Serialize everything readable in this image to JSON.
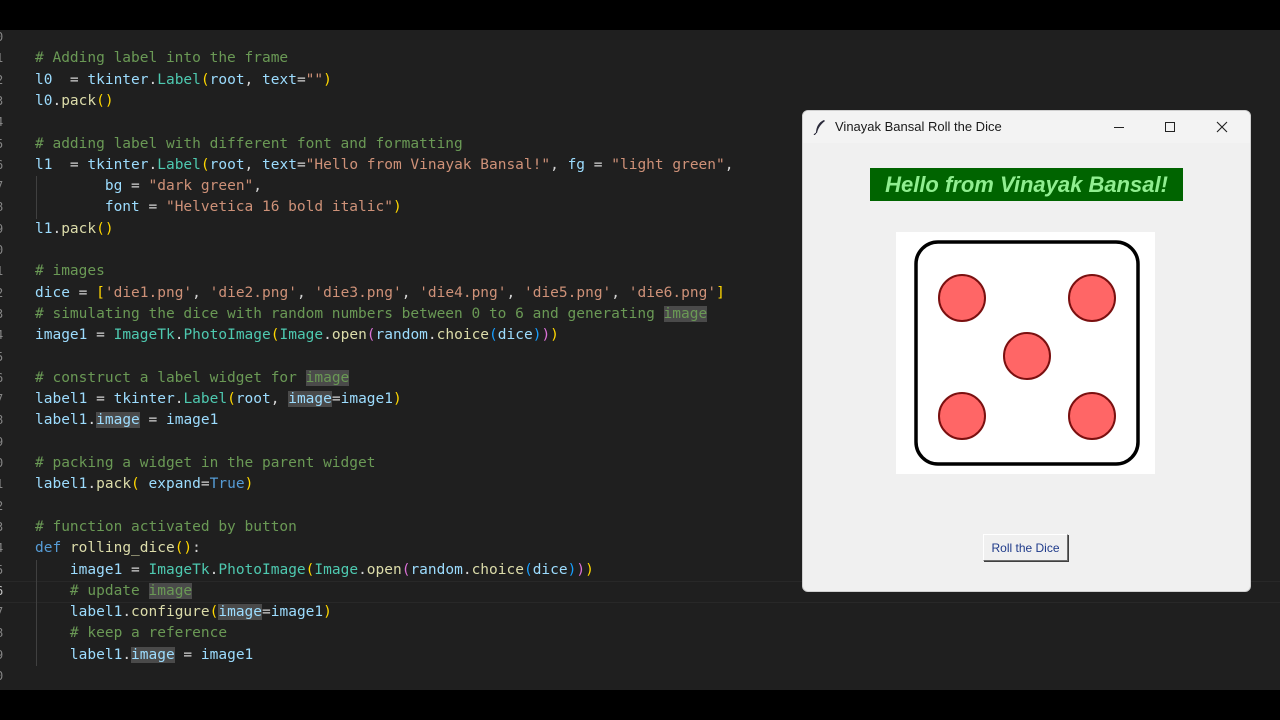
{
  "editor": {
    "current_line": "26",
    "lines": [
      {
        "n": "0"
      },
      {
        "n": "1",
        "t": [
          [
            "cm",
            "# Adding label into the frame"
          ]
        ]
      },
      {
        "n": "2",
        "t": [
          [
            "var",
            "l0"
          ],
          [
            "",
            "  = "
          ],
          [
            "var",
            "tkinter"
          ],
          [
            "",
            "."
          ],
          [
            "cls",
            "Label"
          ],
          [
            "p1",
            "("
          ],
          [
            "var",
            "root"
          ],
          [
            "",
            ", "
          ],
          [
            "var",
            "text"
          ],
          [
            "",
            "="
          ],
          [
            "str",
            "\"\""
          ],
          [
            "p1",
            ")"
          ]
        ]
      },
      {
        "n": "3",
        "t": [
          [
            "var",
            "l0"
          ],
          [
            "",
            "."
          ],
          [
            "fn",
            "pack"
          ],
          [
            "p1",
            "()"
          ]
        ]
      },
      {
        "n": "4"
      },
      {
        "n": "5",
        "t": [
          [
            "cm",
            "# adding label with different font and formatting"
          ]
        ]
      },
      {
        "n": "6",
        "t": [
          [
            "var",
            "l1"
          ],
          [
            "",
            "  = "
          ],
          [
            "var",
            "tkinter"
          ],
          [
            "",
            "."
          ],
          [
            "cls",
            "Label"
          ],
          [
            "p1",
            "("
          ],
          [
            "var",
            "root"
          ],
          [
            "",
            ", "
          ],
          [
            "var",
            "text"
          ],
          [
            "",
            "="
          ],
          [
            "str",
            "\"Hello from Vinayak Bansal!\""
          ],
          [
            "",
            ", "
          ],
          [
            "var",
            "fg"
          ],
          [
            "",
            " = "
          ],
          [
            "str",
            "\"light green\""
          ],
          [
            "",
            ","
          ]
        ]
      },
      {
        "n": "7",
        "t": [
          [
            "",
            "        "
          ],
          [
            "var",
            "bg"
          ],
          [
            "",
            " = "
          ],
          [
            "str",
            "\"dark green\""
          ],
          [
            "",
            ","
          ]
        ]
      },
      {
        "n": "8",
        "t": [
          [
            "",
            "        "
          ],
          [
            "var",
            "font"
          ],
          [
            "",
            " = "
          ],
          [
            "str",
            "\"Helvetica 16 bold italic\""
          ],
          [
            "p1",
            ")"
          ]
        ]
      },
      {
        "n": "9",
        "t": [
          [
            "var",
            "l1"
          ],
          [
            "",
            "."
          ],
          [
            "fn",
            "pack"
          ],
          [
            "p1",
            "()"
          ]
        ]
      },
      {
        "n": "0"
      },
      {
        "n": "1",
        "t": [
          [
            "cm",
            "# images"
          ]
        ]
      },
      {
        "n": "2",
        "t": [
          [
            "var",
            "dice"
          ],
          [
            "",
            " = "
          ],
          [
            "p1",
            "["
          ],
          [
            "str",
            "'die1.png'"
          ],
          [
            "",
            ", "
          ],
          [
            "str",
            "'die2.png'"
          ],
          [
            "",
            ", "
          ],
          [
            "str",
            "'die3.png'"
          ],
          [
            "",
            ", "
          ],
          [
            "str",
            "'die4.png'"
          ],
          [
            "",
            ", "
          ],
          [
            "str",
            "'die5.png'"
          ],
          [
            "",
            ", "
          ],
          [
            "str",
            "'die6.png'"
          ],
          [
            "p1",
            "]"
          ]
        ]
      },
      {
        "n": "3",
        "t": [
          [
            "cm",
            "# simulating the dice with random numbers between 0 to 6 and generating "
          ],
          [
            "cm hl",
            "image"
          ]
        ]
      },
      {
        "n": "4",
        "t": [
          [
            "var",
            "image1"
          ],
          [
            "",
            " = "
          ],
          [
            "cls",
            "ImageTk"
          ],
          [
            "",
            "."
          ],
          [
            "cls",
            "PhotoImage"
          ],
          [
            "p1",
            "("
          ],
          [
            "cls",
            "Image"
          ],
          [
            "",
            "."
          ],
          [
            "fn",
            "open"
          ],
          [
            "p2",
            "("
          ],
          [
            "var",
            "random"
          ],
          [
            "",
            "."
          ],
          [
            "fn",
            "choice"
          ],
          [
            "p3",
            "("
          ],
          [
            "var",
            "dice"
          ],
          [
            "p3",
            ")"
          ],
          [
            "p2",
            ")"
          ],
          [
            "p1",
            ")"
          ]
        ]
      },
      {
        "n": "5"
      },
      {
        "n": "6",
        "t": [
          [
            "cm",
            "# construct a label widget for "
          ],
          [
            "cm hl",
            "image"
          ]
        ]
      },
      {
        "n": "7",
        "t": [
          [
            "var",
            "label1"
          ],
          [
            "",
            " = "
          ],
          [
            "var",
            "tkinter"
          ],
          [
            "",
            "."
          ],
          [
            "cls",
            "Label"
          ],
          [
            "p1",
            "("
          ],
          [
            "var",
            "root"
          ],
          [
            "",
            ", "
          ],
          [
            "var hl",
            "image"
          ],
          [
            "",
            "="
          ],
          [
            "var",
            "image1"
          ],
          [
            "p1",
            ")"
          ]
        ]
      },
      {
        "n": "8",
        "t": [
          [
            "var",
            "label1"
          ],
          [
            "",
            "."
          ],
          [
            "var hl",
            "image"
          ],
          [
            "",
            " = "
          ],
          [
            "var",
            "image1"
          ]
        ]
      },
      {
        "n": "9"
      },
      {
        "n": "0",
        "t": [
          [
            "cm",
            "# packing a widget in the parent widget"
          ]
        ]
      },
      {
        "n": "1",
        "t": [
          [
            "var",
            "label1"
          ],
          [
            "",
            "."
          ],
          [
            "fn",
            "pack"
          ],
          [
            "p1",
            "("
          ],
          [
            "",
            " "
          ],
          [
            "var",
            "expand"
          ],
          [
            "",
            "="
          ],
          [
            "kw",
            "True"
          ],
          [
            "p1",
            ")"
          ]
        ]
      },
      {
        "n": "2"
      },
      {
        "n": "3",
        "t": [
          [
            "cm",
            "# function activated by button"
          ]
        ]
      },
      {
        "n": "4",
        "t": [
          [
            "kw",
            "def"
          ],
          [
            "",
            " "
          ],
          [
            "fn",
            "rolling_dice"
          ],
          [
            "p1",
            "()"
          ],
          [
            "",
            ":"
          ]
        ]
      },
      {
        "n": "5",
        "t": [
          [
            "",
            "    "
          ],
          [
            "var",
            "image1"
          ],
          [
            "",
            " = "
          ],
          [
            "cls",
            "ImageTk"
          ],
          [
            "",
            "."
          ],
          [
            "cls",
            "PhotoImage"
          ],
          [
            "p1",
            "("
          ],
          [
            "cls",
            "Image"
          ],
          [
            "",
            "."
          ],
          [
            "fn",
            "open"
          ],
          [
            "p2",
            "("
          ],
          [
            "var",
            "random"
          ],
          [
            "",
            "."
          ],
          [
            "fn",
            "choice"
          ],
          [
            "p3",
            "("
          ],
          [
            "var",
            "dice"
          ],
          [
            "p3",
            ")"
          ],
          [
            "p2",
            ")"
          ],
          [
            "p1",
            ")"
          ]
        ]
      },
      {
        "n": "6",
        "t": [
          [
            "",
            "    "
          ],
          [
            "cm",
            "# update "
          ],
          [
            "cm hl",
            "image"
          ]
        ]
      },
      {
        "n": "7",
        "t": [
          [
            "",
            "    "
          ],
          [
            "var",
            "label1"
          ],
          [
            "",
            "."
          ],
          [
            "fn",
            "configure"
          ],
          [
            "p1",
            "("
          ],
          [
            "var hl",
            "image"
          ],
          [
            "",
            "="
          ],
          [
            "var",
            "image1"
          ],
          [
            "p1",
            ")"
          ]
        ]
      },
      {
        "n": "8",
        "t": [
          [
            "",
            "    "
          ],
          [
            "cm",
            "# keep a reference"
          ]
        ]
      },
      {
        "n": "9",
        "t": [
          [
            "",
            "    "
          ],
          [
            "var",
            "label1"
          ],
          [
            "",
            "."
          ],
          [
            "var hl",
            "image"
          ],
          [
            "",
            " = "
          ],
          [
            "var",
            "image1"
          ]
        ]
      },
      {
        "n": "0"
      }
    ]
  },
  "window": {
    "title": "Vinayak Bansal Roll the Dice",
    "label_text": "Hello from Vinayak Bansal!",
    "label_fg": "#90ee90",
    "label_bg": "#006400",
    "button_label": "Roll the Dice",
    "die_face": 5,
    "pip_color": "#ff6666"
  }
}
